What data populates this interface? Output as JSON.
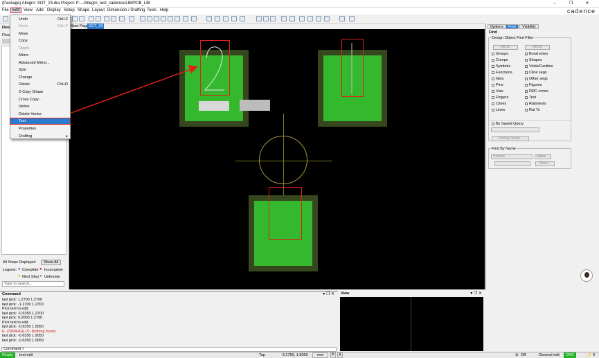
{
  "window": {
    "title": "(Package) Allegro: SOT_23.dra  Project: F:.../Allegro_test_cadence/LIB/PCB_LIB",
    "controls": [
      "–",
      "❐",
      "✕"
    ]
  },
  "brand": "cadence",
  "menubar": [
    "File",
    "Edit",
    "View",
    "Add",
    "Display",
    "Setup",
    "Shape",
    "Layout",
    "Dimension / Drafting",
    "Tools",
    "Help"
  ],
  "tabs": [
    "Start Page",
    "SOT_23"
  ],
  "left_panel": {
    "header_partial": "Desi",
    "flow_partial": "Flow",
    "steps_status": "All Steps Displayed",
    "show_all": "Show All",
    "legend_label": "Legend:",
    "legend_complete": "Complete",
    "legend_incomplete": "Incomplete",
    "legend_next": "Next Step",
    "legend_unknown": "Unknown",
    "search_placeholder": "Type to search..."
  },
  "edit_menu": [
    {
      "label": "Undo",
      "shortcut": "Ctrl+Z",
      "state": "enabled"
    },
    {
      "label": "Redo",
      "shortcut": "Ctrl+Y",
      "state": "disabled"
    },
    {
      "label": "Move",
      "shortcut": "",
      "state": "enabled"
    },
    {
      "label": "Copy",
      "shortcut": "",
      "state": "enabled"
    },
    {
      "label": "Ripple",
      "shortcut": "",
      "state": "disabled"
    },
    {
      "label": "Mirror",
      "shortcut": "",
      "state": "enabled"
    },
    {
      "label": "Advanced Mirror...",
      "shortcut": "",
      "state": "enabled"
    },
    {
      "label": "Spin",
      "shortcut": "",
      "state": "enabled"
    },
    {
      "label": "Change",
      "shortcut": "",
      "state": "enabled"
    },
    {
      "label": "Delete",
      "shortcut": "Ctrl+D",
      "state": "enabled"
    },
    {
      "label": "Z-Copy Shape",
      "shortcut": "",
      "state": "enabled"
    },
    {
      "label": "Cross Copy...",
      "shortcut": "",
      "state": "enabled"
    },
    {
      "label": "Vertex",
      "shortcut": "",
      "state": "enabled"
    },
    {
      "label": "Delete Vertex",
      "shortcut": "",
      "state": "enabled"
    },
    {
      "label": "Text",
      "shortcut": "",
      "state": "selected"
    },
    {
      "label": "Properties",
      "shortcut": "",
      "state": "enabled"
    },
    {
      "label": "Drafting",
      "shortcut": "▸",
      "state": "enabled"
    }
  ],
  "right_panel": {
    "tabs": [
      "Options",
      "Find",
      "Visibility"
    ],
    "find_title": "Find",
    "group_title": "Design Object Find Filter",
    "all_on": "All On",
    "all_off": "All Off",
    "filters_left": [
      "Groups",
      "Comps",
      "Symbols",
      "Functions",
      "Nets",
      "Pins",
      "Vias",
      "Fingers",
      "Clines",
      "Lines"
    ],
    "filters_right": [
      "Bond wires",
      "Shapes",
      "Voids/Cavities",
      "Cline segs",
      "Other segs",
      "Figures",
      "DRC errors",
      "Text",
      "Ratsnests",
      "Rat Ts"
    ],
    "by_saved_query": "By Saved Query",
    "find_by_query": "Find by Query...",
    "find_by_name": "Find By Name",
    "name_type": "Symbol",
    "name_mode": "Name",
    "more_btn": "More..."
  },
  "command_panel": {
    "title": "Command",
    "log": [
      {
        "text": "last pick:  1.2700 1.2700",
        "error": false
      },
      {
        "text": "last pick:  -1.2700 1.2700",
        "error": false
      },
      {
        "text": "Pick text to edit.",
        "error": false
      },
      {
        "text": "last pick:  -0.6350 1.2700",
        "error": false
      },
      {
        "text": "last pick:  0.0000 1.2700",
        "error": false
      },
      {
        "text": "Pick text to edit.",
        "error": false
      },
      {
        "text": "last pick:  -0.6350 1.9050",
        "error": false
      },
      {
        "text": "E- (SPMHGE-7): Nothing found.",
        "error": true
      },
      {
        "text": "last pick:  -0.6350 1.9050",
        "error": false
      },
      {
        "text": "last pick:  -0.6350 1.9050",
        "error": false
      }
    ],
    "prompt": "Command >"
  },
  "view_panel": {
    "title": "View"
  },
  "status": {
    "ready": "Ready",
    "mode": "text edit",
    "layer": "Top",
    "coords": "-3.1750, 1.9050",
    "units": "mm",
    "p": "P",
    "a": "A",
    "off": "Off",
    "general_edit": "General edit",
    "drc": "DRC",
    "count": "0"
  },
  "colors": {
    "pad_fill": "#34b82e",
    "pad_border": "#36471e",
    "highlight": "#e0201a",
    "accent": "#2a7ad0"
  }
}
